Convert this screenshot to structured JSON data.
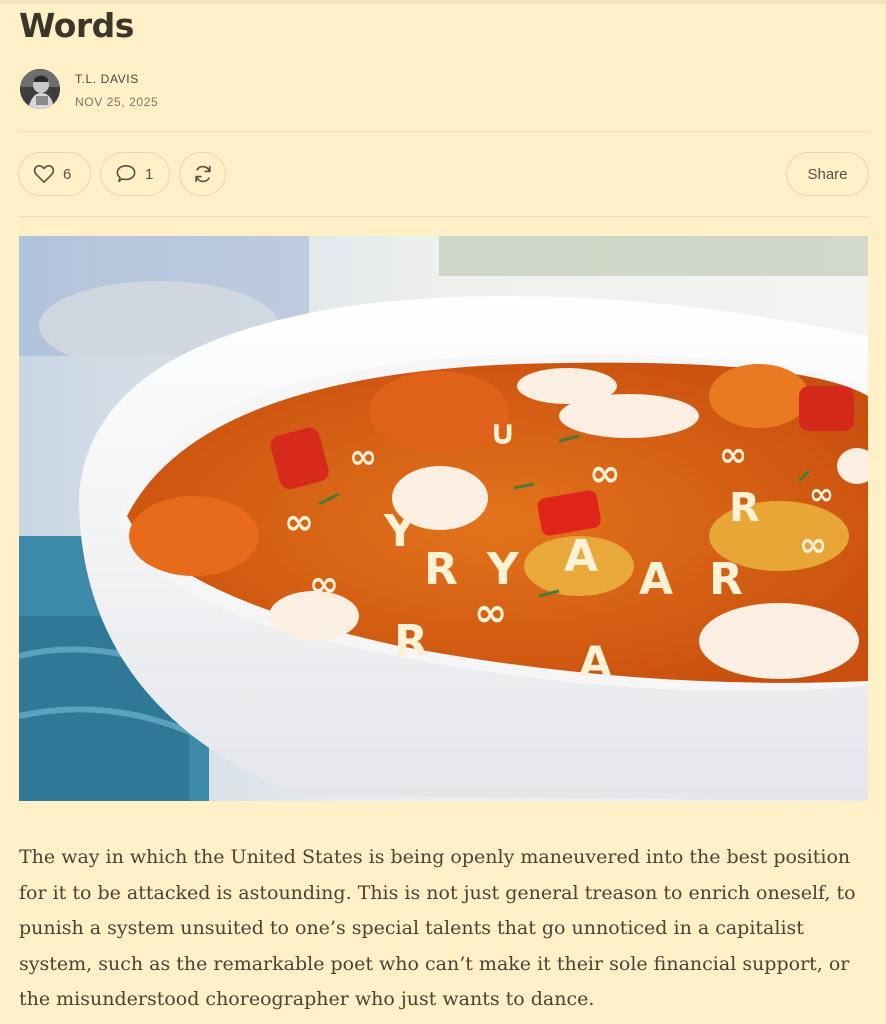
{
  "post": {
    "title": "Words",
    "author": "T.L. DAVIS",
    "date": "NOV 25, 2025"
  },
  "actions": {
    "likes": "6",
    "comments": "1",
    "share_label": "Share"
  },
  "icons": {
    "like": "heart-icon",
    "comment": "speech-bubble-icon",
    "restack": "refresh-arrows-icon"
  },
  "hero_image": {
    "description_letters": [
      "R",
      "A",
      "Y",
      "R",
      "R",
      "R",
      "A",
      "R"
    ]
  },
  "body": {
    "paragraph": "The way in which the United States is being openly maneuvered into the best position for it to be attacked is astounding. This is not just general treason to enrich oneself, to punish a system unsuited to one’s special talents that go unnoticed in a capitalist system, such as the remarkable poet who can’t make it their sole financial support, or the misunderstood choreographer who just wants to dance."
  },
  "colors": {
    "background": "#fff0c8",
    "border": "#e8d6aa",
    "text": "#3a3424"
  }
}
